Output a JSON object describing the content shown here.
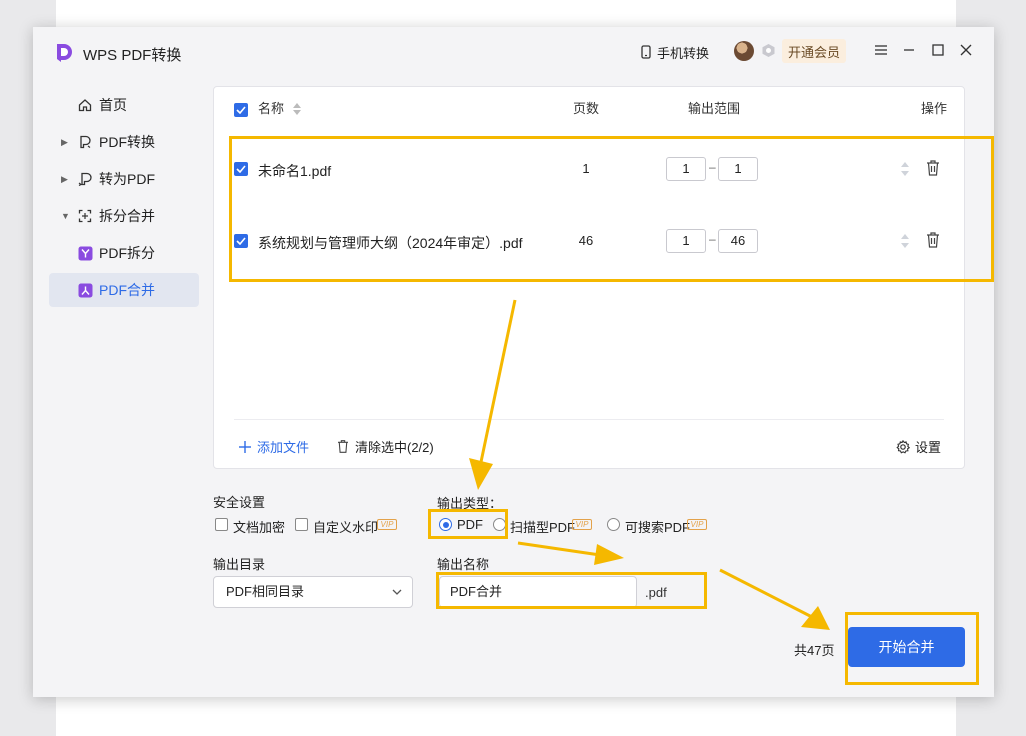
{
  "app": {
    "title": "WPS PDF转换"
  },
  "titlebar": {
    "phone_label": "手机转换",
    "vip_label": "开通会员"
  },
  "sidebar": {
    "items": [
      {
        "label": "首页",
        "icon": "home-icon"
      },
      {
        "label": "PDF转换",
        "icon": "pdf-convert-icon",
        "expandable": true
      },
      {
        "label": "转为PDF",
        "icon": "to-pdf-icon",
        "expandable": true
      },
      {
        "label": "拆分合并",
        "icon": "split-merge-icon",
        "expandable": true,
        "expanded": true
      },
      {
        "label": "PDF拆分",
        "icon": "pdf-split-icon"
      },
      {
        "label": "PDF合并",
        "icon": "pdf-merge-icon",
        "active": true
      }
    ]
  },
  "table": {
    "headers": {
      "name": "名称",
      "pages": "页数",
      "range": "输出范围",
      "action": "操作"
    },
    "rows": [
      {
        "name": "未命名1.pdf",
        "pages": "1",
        "range_from": "1",
        "range_to": "1",
        "checked": true
      },
      {
        "name": "系统规划与管理师大纲（2024年审定）.pdf",
        "pages": "46",
        "range_from": "1",
        "range_to": "46",
        "checked": true
      }
    ],
    "range_separator": "–"
  },
  "panel_footer": {
    "add_file": "添加文件",
    "clear_selected": "清除选中(2/2)",
    "settings": "设置"
  },
  "security": {
    "label": "安全设置",
    "encrypt": "文档加密",
    "watermark": "自定义水印",
    "vip_tag": "VIP"
  },
  "output_type": {
    "label": "输出类型：",
    "options": [
      "PDF",
      "扫描型PDF",
      "可搜索PDF"
    ],
    "selected": "PDF"
  },
  "output_dir": {
    "label": "输出目录",
    "value": "PDF相同目录"
  },
  "output_name": {
    "label": "输出名称",
    "value": "PDF合并",
    "ext": ".pdf"
  },
  "total": "共47页",
  "start_button": "开始合并",
  "colors": {
    "accent": "#2e6be6",
    "highlight": "#f5b800",
    "vip_bg": "#fbeede"
  }
}
